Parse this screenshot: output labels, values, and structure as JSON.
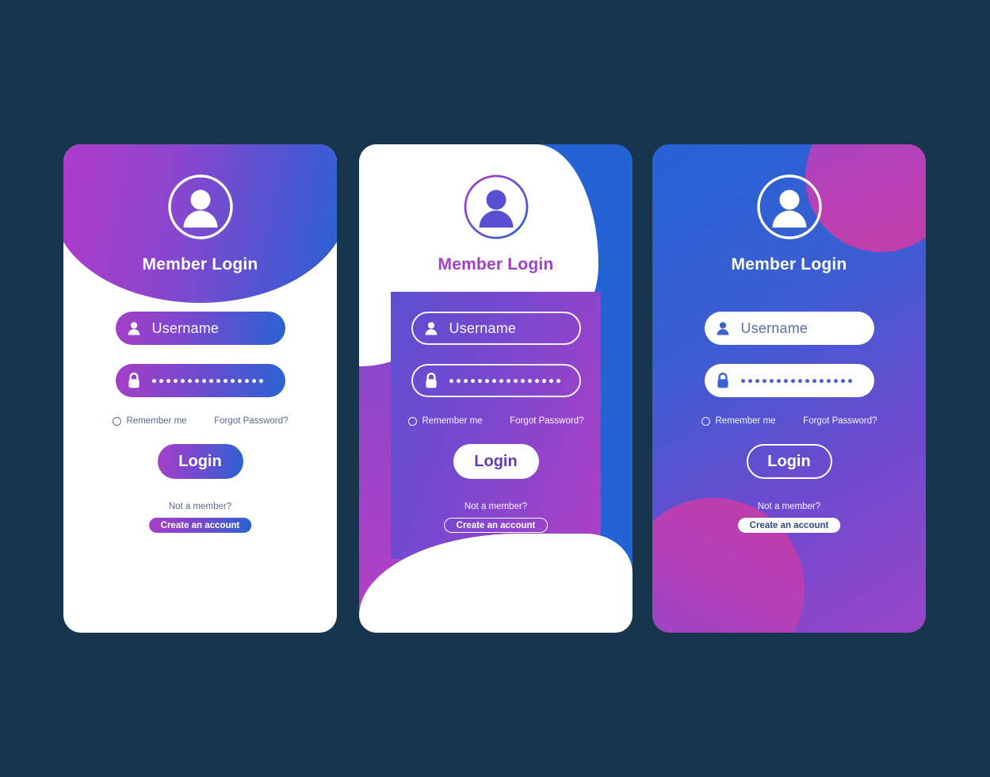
{
  "page": {
    "background_color": "#17354d",
    "title": "Member Login UI Kit"
  },
  "labels": {
    "title": "Member Login",
    "username_placeholder": "Username",
    "password_masked": "••••••••••••••••",
    "password_dot_count": 16,
    "remember_me": "Remember me",
    "forgot_password": "Forgot Password?",
    "login_button": "Login",
    "not_a_member": "Not a member?",
    "create_account": "Create an account"
  },
  "icons": {
    "avatar": "user-avatar-icon",
    "username": "user-icon",
    "password": "lock-icon",
    "remember": "radio-unchecked-icon"
  },
  "cards": [
    {
      "id": "card-light",
      "variant": "white-card-gradient-header",
      "background": "#ffffff",
      "header_gradient": [
        "#b23ac9",
        "#2463d4"
      ],
      "title_color": "#ffffff",
      "input_style": "gradient-fill",
      "login_style": "gradient-fill",
      "create_style": "gradient-pill"
    },
    {
      "id": "card-wave",
      "variant": "blue-card-white-waves",
      "background": "#2463d4",
      "panel_gradient": [
        "#5b4fd2",
        "#b03fc6"
      ],
      "title_color": "#a13fc7",
      "input_style": "outlined",
      "login_style": "white-fill",
      "create_style": "outlined-pill"
    },
    {
      "id": "card-gradient",
      "variant": "gradient-card-circles",
      "background_gradient": [
        "#2463d4",
        "#9a45c8"
      ],
      "blob_color": "#b840b6",
      "title_color": "#ffffff",
      "input_style": "white-fill",
      "login_style": "outlined",
      "create_style": "white-pill"
    }
  ]
}
